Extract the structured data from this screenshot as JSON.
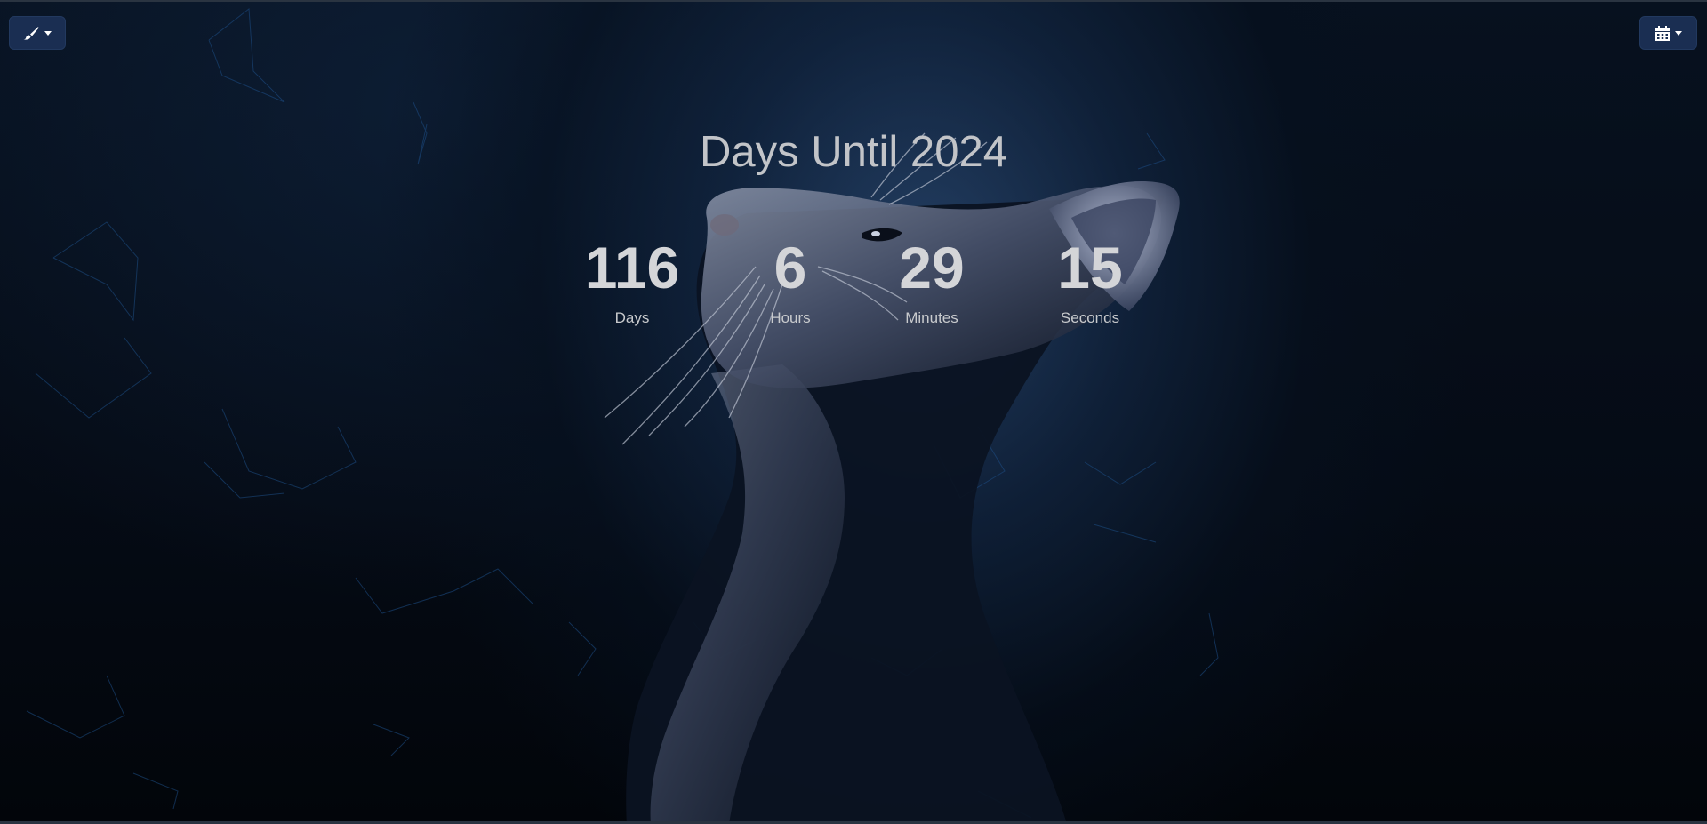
{
  "toolbar": {
    "theme_button_icon": "paintbrush-icon",
    "calendar_button_icon": "calendar-icon"
  },
  "heading": "Days Until 2024",
  "countdown": [
    {
      "value": "116",
      "label": "Days"
    },
    {
      "value": "6",
      "label": "Hours"
    },
    {
      "value": "29",
      "label": "Minutes"
    },
    {
      "value": "15",
      "label": "Seconds"
    }
  ],
  "colors": {
    "button_bg": "#1a2e52",
    "text": "#c2c4c8",
    "background": "#050b15"
  }
}
